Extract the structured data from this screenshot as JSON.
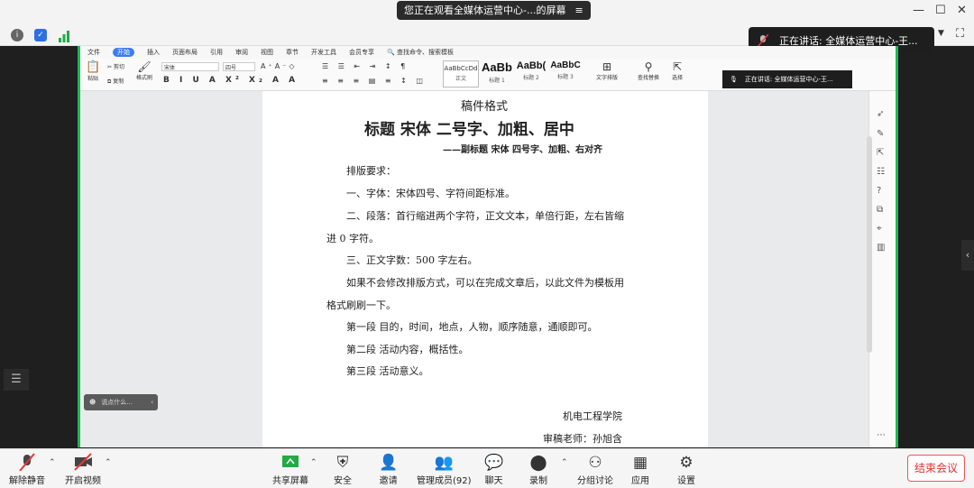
{
  "title_bar": {
    "share_text": "您正在观看全媒体运营中心-...的屏幕",
    "menu_icon": "≡"
  },
  "speaker": {
    "label": "正在讲话: 全媒体运营中心-王..."
  },
  "ribbon": {
    "menu_items": [
      "文件",
      "开始",
      "插入",
      "页面布局",
      "引用",
      "审阅",
      "视图",
      "章节",
      "开发工具",
      "会员专享"
    ],
    "search_placeholder": "查找命令、搜索模板",
    "font_name": "宋体",
    "font_size": "四号",
    "paste_label": "粘贴",
    "cut_label": "剪切",
    "copy_label": "复制",
    "format_painter_label": "格式刷",
    "styles": [
      {
        "preview": "AaBbCcDd",
        "label": "正文"
      },
      {
        "preview": "AaBb",
        "label": "标题 1"
      },
      {
        "preview": "AaBb(",
        "label": "标题 2"
      },
      {
        "preview": "AaBbC",
        "label": "标题 3"
      }
    ],
    "text_layout_label": "文字排版",
    "find_replace_label": "查找替换",
    "select_label": "选择",
    "inner_speaker": "正在讲话: 全媒体运营中心-王..."
  },
  "document": {
    "heading": "稿件格式",
    "title": "标题  宋体  二号字、加粗、居中",
    "subtitle": "——副标题  宋体  四号字、加粗、右对齐",
    "lines": [
      "排版要求：",
      "一、字体：宋体四号、字符间距标准。",
      "二、段落：首行缩进两个字符，正文文本，单倍行距，左右皆缩",
      "进 0 字符。",
      "三、正文字数：500 字左右。",
      "如果不会修改排版方式，可以在完成文章后，以此文件为模板用",
      "格式刷刷一下。",
      "第一段  目的，时间，地点，人物，顺序随意，通顺即可。",
      "第二段  活动内容，概括性。",
      "第三段  活动意义。"
    ],
    "signature_org": "机电工程学院",
    "signature_teacher": "审稿老师：孙旭含"
  },
  "bubble": {
    "text": "说点什么..."
  },
  "toolbar": {
    "unmute": "解除静音",
    "start_video": "开启视频",
    "share_screen": "共享屏幕",
    "security": "安全",
    "invite": "邀请",
    "manage_members": "管理成员(92)",
    "chat": "聊天",
    "record": "录制",
    "breakout": "分组讨论",
    "apps": "应用",
    "settings": "设置",
    "end_meeting": "结束会议"
  },
  "colors": {
    "accent_green": "#1db954",
    "end_red": "#e03030",
    "ribbon_blue": "#3b7cf5"
  }
}
